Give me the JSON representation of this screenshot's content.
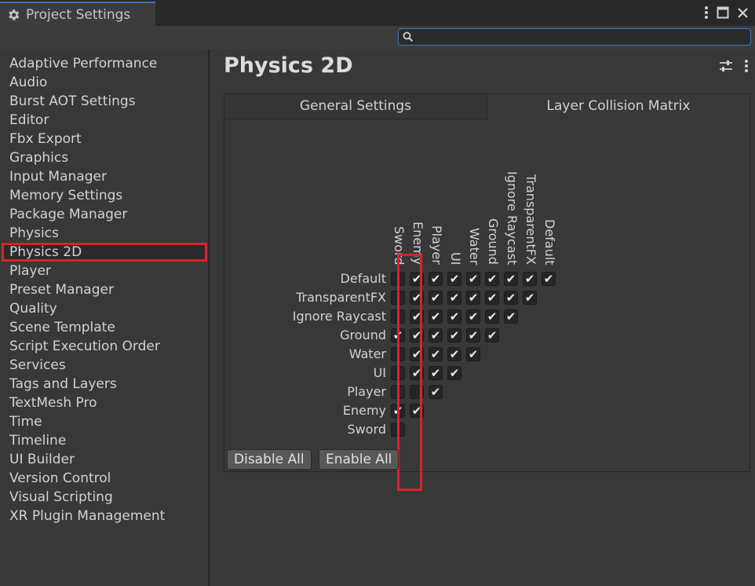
{
  "window": {
    "title": "Project Settings"
  },
  "search": {
    "placeholder": ""
  },
  "sidebar": {
    "items": [
      "Adaptive Performance",
      "Audio",
      "Burst AOT Settings",
      "Editor",
      "Fbx Export",
      "Graphics",
      "Input Manager",
      "Memory Settings",
      "Package Manager",
      "Physics",
      "Physics 2D",
      "Player",
      "Preset Manager",
      "Quality",
      "Scene Template",
      "Script Execution Order",
      "Services",
      "Tags and Layers",
      "TextMesh Pro",
      "Time",
      "Timeline",
      "UI Builder",
      "Version Control",
      "Visual Scripting",
      "XR Plugin Management"
    ],
    "selected": "Physics 2D"
  },
  "page": {
    "title": "Physics 2D"
  },
  "tabs": [
    {
      "label": "General Settings",
      "active": false
    },
    {
      "label": "Layer Collision Matrix",
      "active": true
    }
  ],
  "matrix": {
    "rows": [
      "Default",
      "TransparentFX",
      "Ignore Raycast",
      "Ground",
      "Water",
      "UI",
      "Player",
      "Enemy",
      "Sword"
    ],
    "columns": [
      "Sword",
      "Enemy",
      "Player",
      "UI",
      "Water",
      "Ground",
      "Ignore Raycast",
      "TransparentFX",
      "Default"
    ],
    "checked": [
      [
        false,
        true,
        true,
        true,
        true,
        true,
        true,
        true,
        true
      ],
      [
        false,
        true,
        true,
        true,
        true,
        true,
        true,
        true
      ],
      [
        false,
        true,
        true,
        true,
        true,
        true,
        true
      ],
      [
        true,
        true,
        true,
        true,
        true,
        true
      ],
      [
        false,
        true,
        true,
        true,
        true
      ],
      [
        false,
        true,
        true,
        true
      ],
      [
        false,
        false,
        true
      ],
      [
        true,
        true
      ],
      [
        false
      ]
    ],
    "highlighted_column": "Sword"
  },
  "buttons": {
    "disable_all": "Disable All",
    "enable_all": "Enable All"
  },
  "colors": {
    "highlight": "#d9222d",
    "focus": "#3a79bb"
  },
  "icons": [
    "gear-icon",
    "kebab-menu-icon",
    "maximize-icon",
    "close-icon",
    "search-icon",
    "preset-sliders-icon"
  ]
}
